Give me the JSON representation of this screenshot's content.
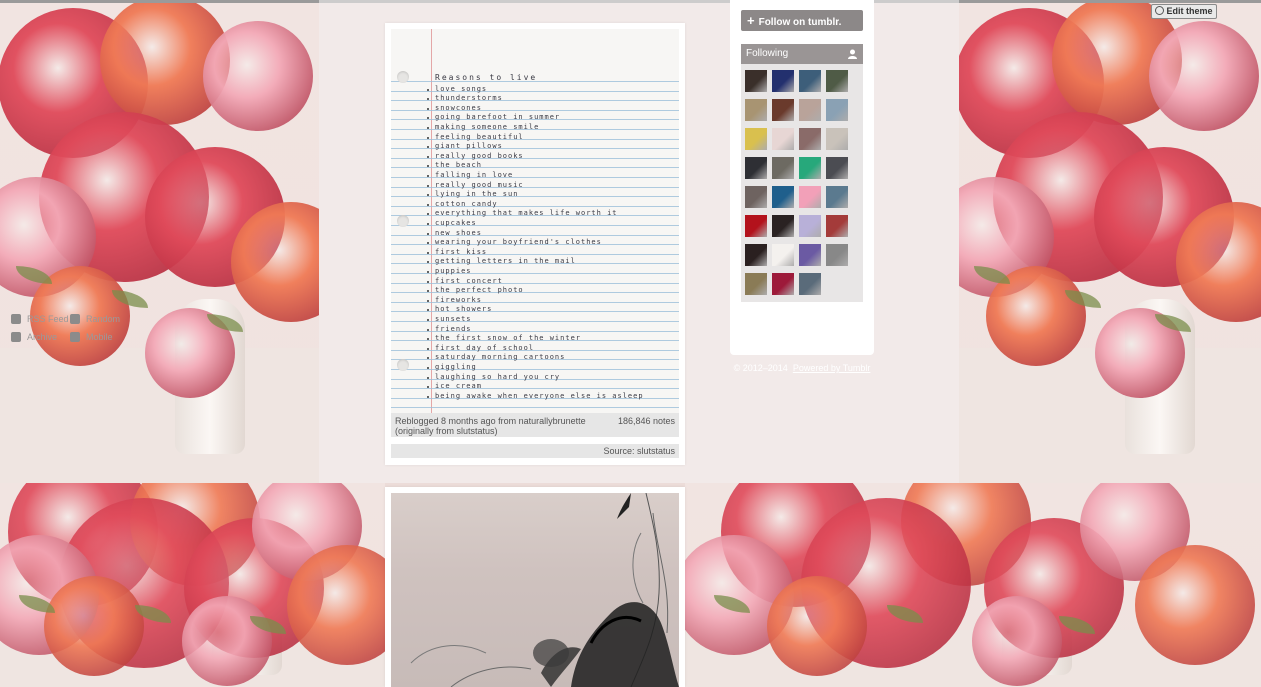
{
  "header": {
    "edit_theme_label": "Edit theme"
  },
  "post1": {
    "image_label": "Reasons to live",
    "note_lines": [
      "Reasons to live",
      "love songs",
      "thunderstorms",
      "snowcones",
      "going barefoot in summer",
      "making someone smile",
      "feeling beautiful",
      "giant pillows",
      "really good books",
      "the beach",
      "falling in love",
      "really good music",
      "lying in the sun",
      "cotton candy",
      "everything that makes life worth it",
      "cupcakes",
      "new shoes",
      "wearing your boyfriend's clothes",
      "first kiss",
      "getting letters in the mail",
      "puppies",
      "first concert",
      "the perfect photo",
      "fireworks",
      "hot showers",
      "sunsets",
      "friends",
      "the first snow of the winter",
      "first day of school",
      "saturday morning cartoons",
      "giggling",
      "laughing so hard you cry",
      "ice cream",
      "being awake when everyone else is asleep"
    ],
    "reblog_text": "Reblogged 8 months ago from naturallybrunette (originally from slutstatus)",
    "notes": "186,846 notes",
    "source": "Source: slutstatus"
  },
  "post2": {
    "image_label": "pencil sketch"
  },
  "sidebar": {
    "follow_label": "Follow on tumblr.",
    "following_label": "Following",
    "links": [
      {
        "label": "RSS Feed",
        "icon": "rss-icon"
      },
      {
        "label": "Random",
        "icon": "shuffle-icon"
      },
      {
        "label": "Archive",
        "icon": "archive-icon"
      },
      {
        "label": "Mobile",
        "icon": "mobile-icon"
      }
    ],
    "avatar_colors": [
      "#3a2f2a",
      "#23306e",
      "#3d5e7a",
      "#4f5b46",
      "#a89472",
      "#6a3a2c",
      "#b9a39a",
      "#8aa1b4",
      "#d9c04e",
      "#e7d6d4",
      "#8a6b69",
      "#c9c2ba",
      "#2e2f34",
      "#6d6a62",
      "#27a87b",
      "#4b4c52",
      "#6e6360",
      "#1f5f8c",
      "#f2a0b8",
      "#5b7a8f",
      "#b3121c",
      "#2a2222",
      "#b8b0d8",
      "#a43b3a",
      "#2a2020",
      "#f4f1ee",
      "#6b5aa3",
      "#888888",
      "#8a7b56",
      "#9d1a3a",
      "#5a6b7a"
    ]
  },
  "footer": {
    "copyright": "© 2012–2014",
    "powered_by": "Powered by Tumblr"
  },
  "colors": {
    "rose": "#e04a5a",
    "coral": "#f07a55",
    "pink": "#f3a9b7",
    "sidebar_button": "#8c8888"
  }
}
